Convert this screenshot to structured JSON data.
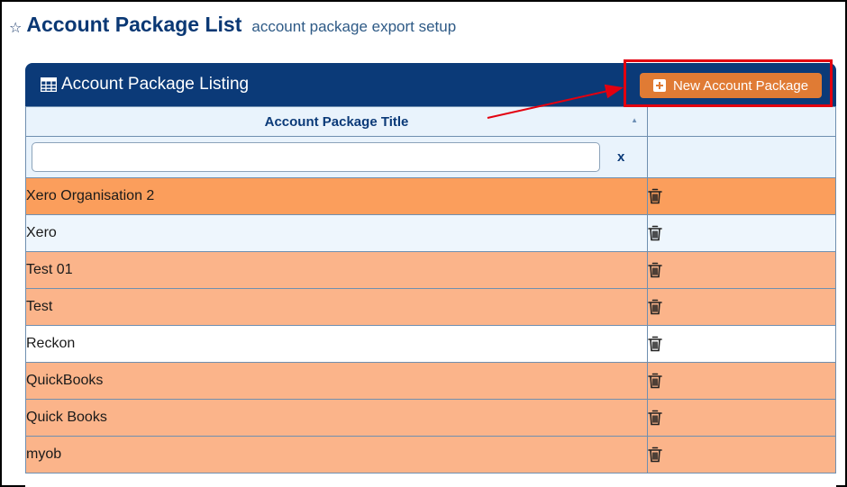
{
  "header": {
    "title": "Account Package List",
    "subtitle": "account package export setup"
  },
  "panel": {
    "title": "Account Package Listing",
    "new_button_label": "New Account Package"
  },
  "table": {
    "column_title": "Account Package Title",
    "filter_value": "",
    "clear_label": "x",
    "rows": [
      {
        "title": "Xero Organisation 2"
      },
      {
        "title": "Xero"
      },
      {
        "title": "Test 01"
      },
      {
        "title": "Test"
      },
      {
        "title": "Reckon"
      },
      {
        "title": "QuickBooks"
      },
      {
        "title": "Quick Books"
      },
      {
        "title": "myob"
      }
    ]
  },
  "colors": {
    "header_blue": "#0b3a78",
    "button_orange": "#e07b34",
    "row_selected": "#fb9e5c",
    "row_orange": "#fbb48a",
    "annotation_red": "#e3000f"
  },
  "icons": [
    "star-icon",
    "table-icon",
    "plus-square-icon",
    "sort-icon",
    "trash-icon"
  ]
}
